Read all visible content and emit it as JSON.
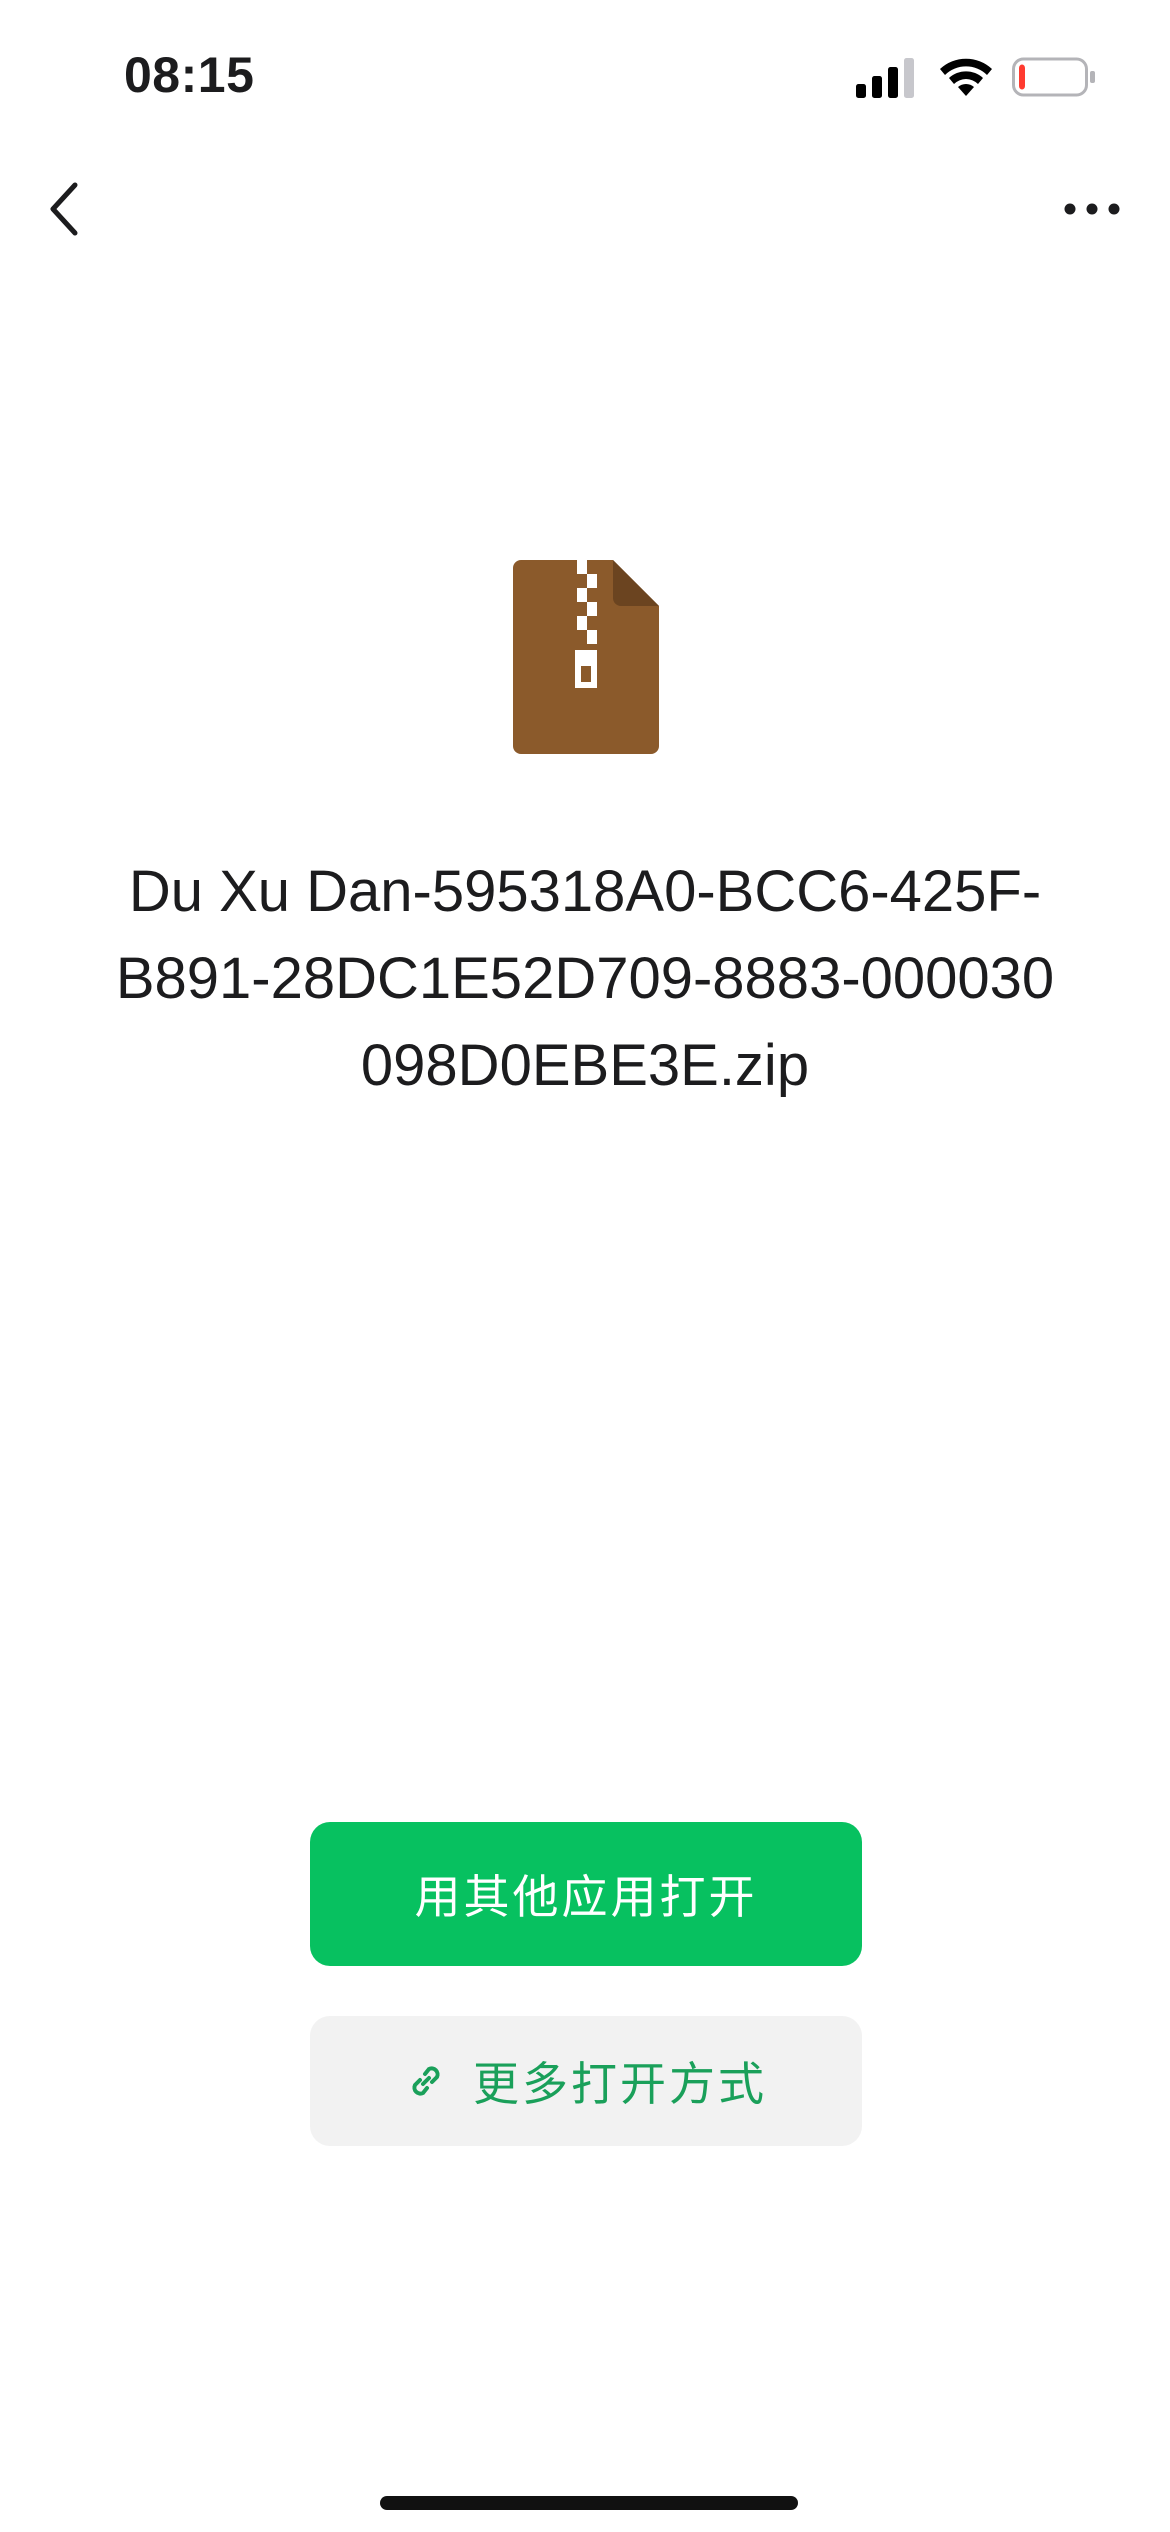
{
  "status_bar": {
    "time": "08:15",
    "icons": [
      "signal-icon",
      "wifi-icon",
      "battery-icon"
    ],
    "battery_level": 0.1,
    "battery_color": "#ff3b30"
  },
  "nav": {
    "back_icon": "chevron-left-icon",
    "more_icon": "ellipsis-icon"
  },
  "file": {
    "icon": "zip-file-icon",
    "icon_color": "#8b5a2b",
    "name": "Du Xu Dan-595318A0-BCC6-425F-B891-28DC1E52D709-8883-000030098D0EBE3E.zip"
  },
  "actions": {
    "open_with_other_app": "用其他应用打开",
    "more_open_methods": "更多打开方式",
    "link_icon": "link-icon",
    "primary_color": "#07c160"
  }
}
